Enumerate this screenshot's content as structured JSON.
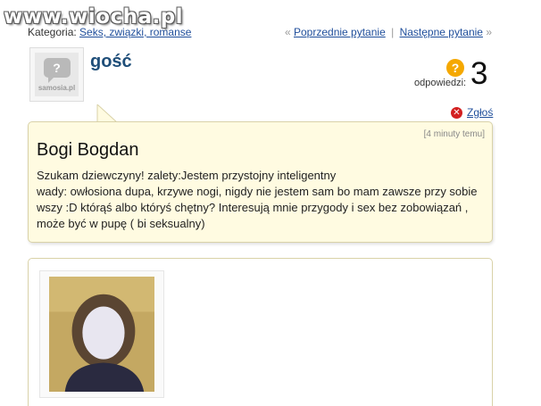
{
  "watermark": "www.wiocha.pl",
  "breadcrumb": {
    "label": "Kategoria:",
    "category": "Seks, związki, romanse"
  },
  "nav": {
    "prev_arrow": "«",
    "prev": "Poprzednie pytanie",
    "separator": "|",
    "next": "Następne pytanie",
    "next_arrow": "»"
  },
  "avatar": {
    "brand": "samosia.pl",
    "glyph": "?"
  },
  "user": {
    "name": "gość"
  },
  "answers": {
    "icon": "?",
    "label": "odpowiedzi:",
    "count": "3"
  },
  "report": {
    "icon": "x-icon",
    "label": "Zgłoś"
  },
  "question": {
    "time": "[4 minuty temu]",
    "title": "Bogi Bogdan",
    "body_line1": "Szukam dziewczyny! zalety:Jestem przystojny inteligentny",
    "body_line2": "wady: owłosiona dupa, krzywe nogi, nigdy nie jestem sam bo mam zawsze przy sobie wszy :D którąś albo któryś chętny? Interesują mnie przygody i sex bez zobowiązań , może być w pupę ( bi seksualny)"
  },
  "colors": {
    "link": "#1f4e9b",
    "username": "#1f4e79",
    "question_bg": "#fffbe1",
    "border": "#d9d2a8",
    "answers_icon": "#f5a800",
    "report_icon": "#d32020"
  }
}
